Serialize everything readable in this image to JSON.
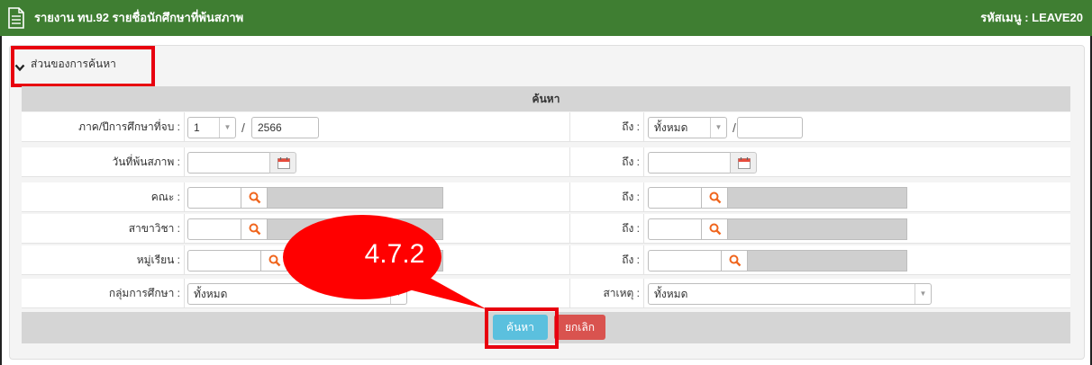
{
  "titlebar": {
    "title": "รายงาน ทบ.92 รายชื่อนักศึกษาที่พ้นสภาพ",
    "menu_code": "รหัสเมนู : LEAVE20"
  },
  "search_section": {
    "toggle_label": "ส่วนของการค้นหา",
    "header": "ค้นหา"
  },
  "form": {
    "term_year_label": "ภาค/ปีการศึกษาที่จบ :",
    "term_value": "1",
    "year_value": "2566",
    "to_label": "ถึง :",
    "to_term_value": "ทั้งหมด",
    "to_year_value": "",
    "leave_date_label": "วันที่พ้นสภาพ :",
    "leave_date_value": "",
    "to_leave_date_value": "",
    "faculty_label": "คณะ :",
    "faculty_code": "",
    "faculty_name": "",
    "to_faculty_code": "",
    "to_faculty_name": "",
    "major_label": "สาขาวิชา :",
    "major_code": "",
    "major_name": "",
    "to_major_code": "",
    "to_major_name": "",
    "group_label": "หมู่เรียน :",
    "group_code": "",
    "group_name": "",
    "to_group_code": "",
    "to_group_name": "",
    "education_group_label": "กลุ่มการศึกษา :",
    "education_group_value": "ทั้งหมด",
    "cause_label": "สาเหตุ :",
    "cause_value": "ทั้งหมด"
  },
  "buttons": {
    "search_label": "ค้นหา",
    "cancel_label": "ยกเลิก"
  },
  "annotation": {
    "callout_text": "4.7.2"
  },
  "colors": {
    "titlebar": "#3f7e32",
    "search_button": "#5bc0de",
    "cancel_button": "#d9534f",
    "highlight": "#e8000f",
    "search_icon": "#f0661e"
  },
  "icons": [
    "document-icon",
    "chevron-down-icon",
    "calendar-icon",
    "search-icon"
  ]
}
